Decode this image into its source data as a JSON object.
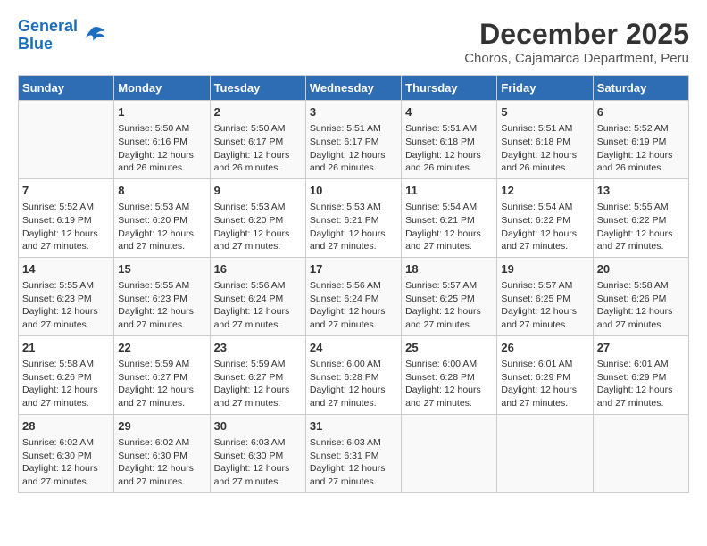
{
  "header": {
    "logo_line1": "General",
    "logo_line2": "Blue",
    "main_title": "December 2025",
    "subtitle": "Choros, Cajamarca Department, Peru"
  },
  "columns": [
    "Sunday",
    "Monday",
    "Tuesday",
    "Wednesday",
    "Thursday",
    "Friday",
    "Saturday"
  ],
  "weeks": [
    [
      {
        "day": "",
        "info": ""
      },
      {
        "day": "1",
        "info": "Sunrise: 5:50 AM\nSunset: 6:16 PM\nDaylight: 12 hours\nand 26 minutes."
      },
      {
        "day": "2",
        "info": "Sunrise: 5:50 AM\nSunset: 6:17 PM\nDaylight: 12 hours\nand 26 minutes."
      },
      {
        "day": "3",
        "info": "Sunrise: 5:51 AM\nSunset: 6:17 PM\nDaylight: 12 hours\nand 26 minutes."
      },
      {
        "day": "4",
        "info": "Sunrise: 5:51 AM\nSunset: 6:18 PM\nDaylight: 12 hours\nand 26 minutes."
      },
      {
        "day": "5",
        "info": "Sunrise: 5:51 AM\nSunset: 6:18 PM\nDaylight: 12 hours\nand 26 minutes."
      },
      {
        "day": "6",
        "info": "Sunrise: 5:52 AM\nSunset: 6:19 PM\nDaylight: 12 hours\nand 26 minutes."
      }
    ],
    [
      {
        "day": "7",
        "info": "Sunrise: 5:52 AM\nSunset: 6:19 PM\nDaylight: 12 hours\nand 27 minutes."
      },
      {
        "day": "8",
        "info": "Sunrise: 5:53 AM\nSunset: 6:20 PM\nDaylight: 12 hours\nand 27 minutes."
      },
      {
        "day": "9",
        "info": "Sunrise: 5:53 AM\nSunset: 6:20 PM\nDaylight: 12 hours\nand 27 minutes."
      },
      {
        "day": "10",
        "info": "Sunrise: 5:53 AM\nSunset: 6:21 PM\nDaylight: 12 hours\nand 27 minutes."
      },
      {
        "day": "11",
        "info": "Sunrise: 5:54 AM\nSunset: 6:21 PM\nDaylight: 12 hours\nand 27 minutes."
      },
      {
        "day": "12",
        "info": "Sunrise: 5:54 AM\nSunset: 6:22 PM\nDaylight: 12 hours\nand 27 minutes."
      },
      {
        "day": "13",
        "info": "Sunrise: 5:55 AM\nSunset: 6:22 PM\nDaylight: 12 hours\nand 27 minutes."
      }
    ],
    [
      {
        "day": "14",
        "info": "Sunrise: 5:55 AM\nSunset: 6:23 PM\nDaylight: 12 hours\nand 27 minutes."
      },
      {
        "day": "15",
        "info": "Sunrise: 5:55 AM\nSunset: 6:23 PM\nDaylight: 12 hours\nand 27 minutes."
      },
      {
        "day": "16",
        "info": "Sunrise: 5:56 AM\nSunset: 6:24 PM\nDaylight: 12 hours\nand 27 minutes."
      },
      {
        "day": "17",
        "info": "Sunrise: 5:56 AM\nSunset: 6:24 PM\nDaylight: 12 hours\nand 27 minutes."
      },
      {
        "day": "18",
        "info": "Sunrise: 5:57 AM\nSunset: 6:25 PM\nDaylight: 12 hours\nand 27 minutes."
      },
      {
        "day": "19",
        "info": "Sunrise: 5:57 AM\nSunset: 6:25 PM\nDaylight: 12 hours\nand 27 minutes."
      },
      {
        "day": "20",
        "info": "Sunrise: 5:58 AM\nSunset: 6:26 PM\nDaylight: 12 hours\nand 27 minutes."
      }
    ],
    [
      {
        "day": "21",
        "info": "Sunrise: 5:58 AM\nSunset: 6:26 PM\nDaylight: 12 hours\nand 27 minutes."
      },
      {
        "day": "22",
        "info": "Sunrise: 5:59 AM\nSunset: 6:27 PM\nDaylight: 12 hours\nand 27 minutes."
      },
      {
        "day": "23",
        "info": "Sunrise: 5:59 AM\nSunset: 6:27 PM\nDaylight: 12 hours\nand 27 minutes."
      },
      {
        "day": "24",
        "info": "Sunrise: 6:00 AM\nSunset: 6:28 PM\nDaylight: 12 hours\nand 27 minutes."
      },
      {
        "day": "25",
        "info": "Sunrise: 6:00 AM\nSunset: 6:28 PM\nDaylight: 12 hours\nand 27 minutes."
      },
      {
        "day": "26",
        "info": "Sunrise: 6:01 AM\nSunset: 6:29 PM\nDaylight: 12 hours\nand 27 minutes."
      },
      {
        "day": "27",
        "info": "Sunrise: 6:01 AM\nSunset: 6:29 PM\nDaylight: 12 hours\nand 27 minutes."
      }
    ],
    [
      {
        "day": "28",
        "info": "Sunrise: 6:02 AM\nSunset: 6:30 PM\nDaylight: 12 hours\nand 27 minutes."
      },
      {
        "day": "29",
        "info": "Sunrise: 6:02 AM\nSunset: 6:30 PM\nDaylight: 12 hours\nand 27 minutes."
      },
      {
        "day": "30",
        "info": "Sunrise: 6:03 AM\nSunset: 6:30 PM\nDaylight: 12 hours\nand 27 minutes."
      },
      {
        "day": "31",
        "info": "Sunrise: 6:03 AM\nSunset: 6:31 PM\nDaylight: 12 hours\nand 27 minutes."
      },
      {
        "day": "",
        "info": ""
      },
      {
        "day": "",
        "info": ""
      },
      {
        "day": "",
        "info": ""
      }
    ]
  ]
}
